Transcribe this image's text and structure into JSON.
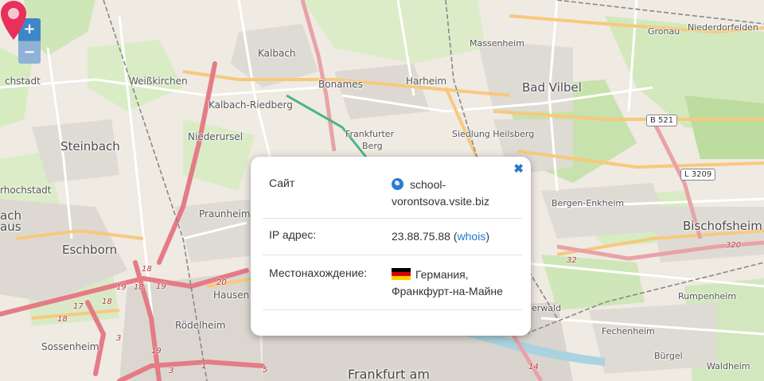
{
  "map": {
    "zoom": {
      "in_label": "+",
      "out_label": "−"
    },
    "places": [
      {
        "id": "chstadt",
        "text": "chstadt"
      },
      {
        "id": "weisskirchen",
        "text": "Weißkirchen"
      },
      {
        "id": "kalbach",
        "text": "Kalbach"
      },
      {
        "id": "bonames",
        "text": "Bonames"
      },
      {
        "id": "harheim",
        "text": "Harheim"
      },
      {
        "id": "massenheim",
        "text": "Massenheim"
      },
      {
        "id": "gronau",
        "text": "Gronau"
      },
      {
        "id": "niederdorfelden",
        "text": "Niederdorfelden"
      },
      {
        "id": "bad-vilbel",
        "text": "Bad Vilbel"
      },
      {
        "id": "kalbach-riedberg",
        "text": "Kalbach-Riedberg"
      },
      {
        "id": "niederursel",
        "text": "Niederursel"
      },
      {
        "id": "frankfurter-berg-1",
        "text": "Frankfurter"
      },
      {
        "id": "frankfurter-berg-2",
        "text": "Berg"
      },
      {
        "id": "siedlung-heilsberg",
        "text": "Siedlung Heilsberg"
      },
      {
        "id": "steinbach",
        "text": "Steinbach"
      },
      {
        "id": "rhochstadt",
        "text": "rhochstadt"
      },
      {
        "id": "bergen-enkheim",
        "text": "Bergen-Enkheim"
      },
      {
        "id": "bischofsheim",
        "text": "Bischofsheim"
      },
      {
        "id": "ach",
        "text": "ach"
      },
      {
        "id": "aus",
        "text": "aus"
      },
      {
        "id": "praunheim",
        "text": "Praunheim"
      },
      {
        "id": "eschborn",
        "text": "Eschborn"
      },
      {
        "id": "hausen",
        "text": "Hausen"
      },
      {
        "id": "rodelheim",
        "text": "Rödelheim"
      },
      {
        "id": "rumpenheim",
        "text": "Rumpenheim"
      },
      {
        "id": "erwald",
        "text": "erwald"
      },
      {
        "id": "fechenheim",
        "text": "Fechenheim"
      },
      {
        "id": "burgel",
        "text": "Bürgel"
      },
      {
        "id": "waldheim",
        "text": "Waldheim"
      },
      {
        "id": "sossenheim",
        "text": "Sossenheim"
      },
      {
        "id": "frankfurt-am",
        "text": "Frankfurt am"
      }
    ],
    "road_shields": [
      {
        "id": "b521",
        "text": "B 521"
      },
      {
        "id": "l3209",
        "text": "L 3209"
      }
    ],
    "road_numbers": [
      {
        "id": "n18a",
        "text": "18"
      },
      {
        "id": "n19a",
        "text": "19"
      },
      {
        "id": "n18b",
        "text": "18"
      },
      {
        "id": "n19b",
        "text": "19"
      },
      {
        "id": "n17",
        "text": "17"
      },
      {
        "id": "n18c",
        "text": "18"
      },
      {
        "id": "n18d",
        "text": "18"
      },
      {
        "id": "n20",
        "text": "20"
      },
      {
        "id": "n19c",
        "text": "19"
      },
      {
        "id": "n3",
        "text": "3"
      },
      {
        "id": "n1",
        "text": "1"
      },
      {
        "id": "n5",
        "text": "5"
      },
      {
        "id": "n32",
        "text": "32"
      },
      {
        "id": "n3a",
        "text": "3"
      },
      {
        "id": "n14",
        "text": "14"
      },
      {
        "id": "n320",
        "text": "320"
      }
    ]
  },
  "popup": {
    "close_icon": "close-x-icon",
    "site": {
      "label": "Сайт",
      "value": "school-vorontsova.vsite.biz",
      "value_line1": "school-",
      "value_line2": "vorontsova.vsite.biz",
      "icon": "globe-icon"
    },
    "ip": {
      "label": "IP адрес:",
      "value": "23.88.75.88",
      "link_open": "(",
      "link_text": "whois",
      "link_close": ")"
    },
    "location": {
      "label": "Местонахождение:",
      "country": "Германия,",
      "city": "Франкфурт-на-Майне",
      "flag_colors": [
        "#000000",
        "#dd0000",
        "#ffce00"
      ]
    }
  },
  "colors": {
    "zoom_accent": "#3f86c6",
    "link": "#1f7bd0",
    "marker": "#e8305a",
    "motorway": "#e57b86"
  }
}
